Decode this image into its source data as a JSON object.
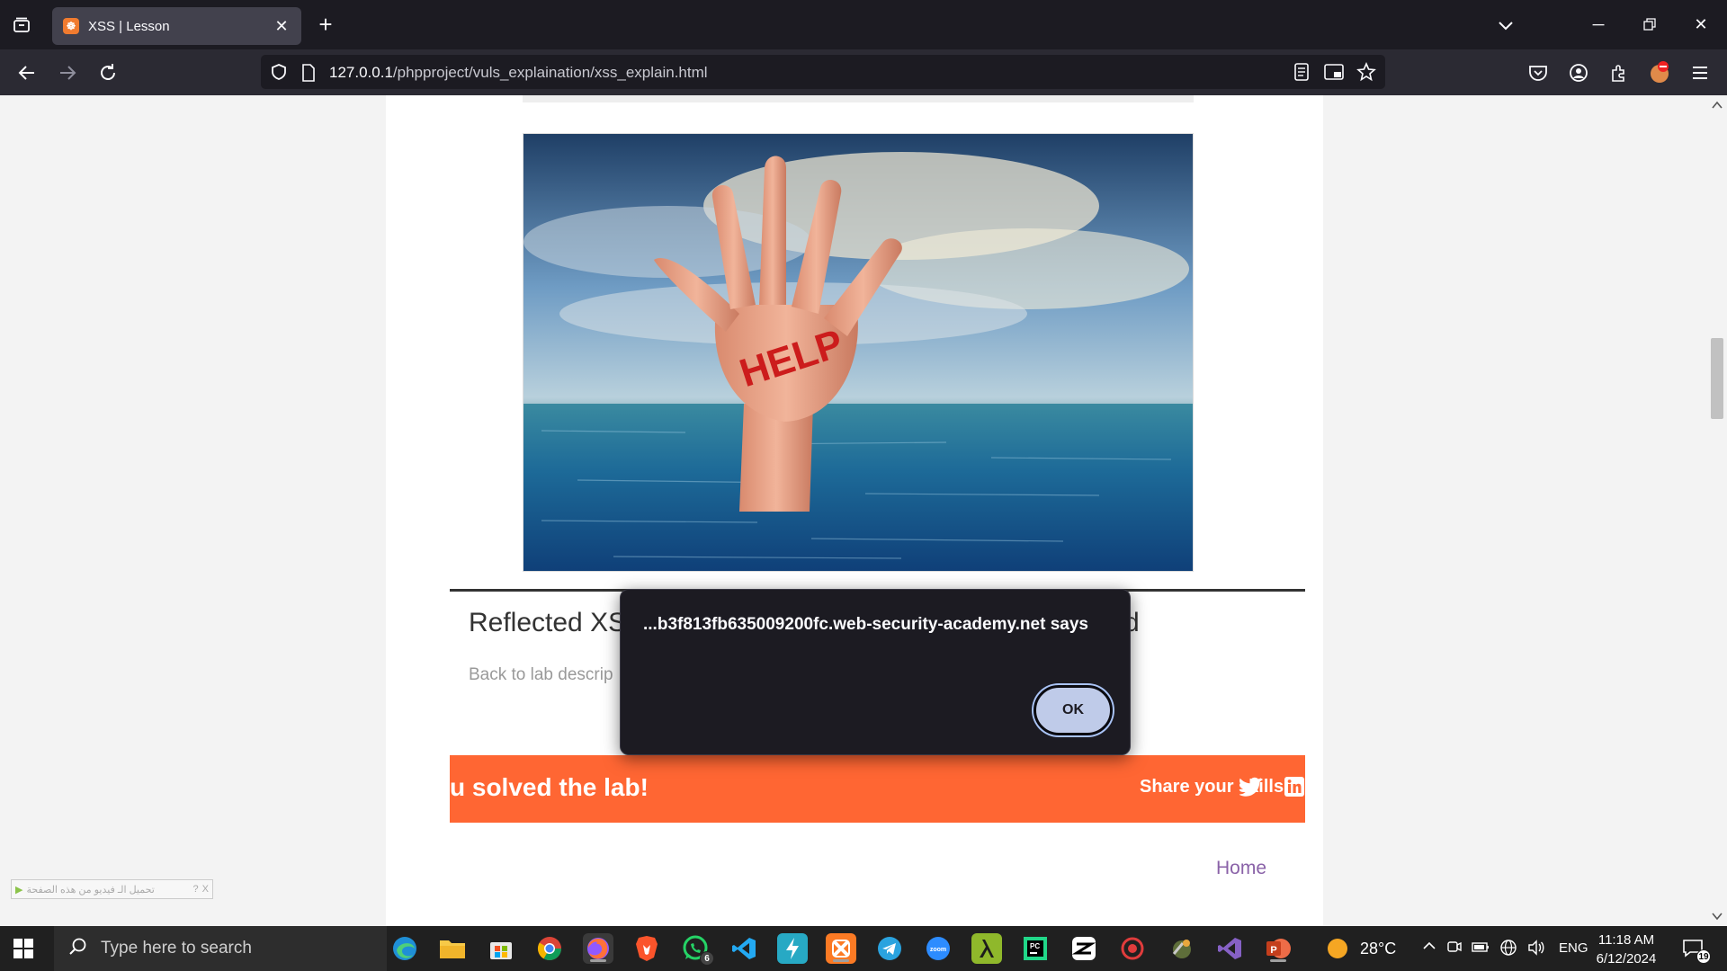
{
  "browser": {
    "tab": {
      "title": "XSS | Lesson",
      "favicon_text": "☸"
    },
    "url": {
      "host": "127.0.0.1",
      "path": "/phpproject/vuls_explaination/xss_explain.html"
    }
  },
  "page": {
    "lab_title": "Reflected XS",
    "lab_title_tail": "d",
    "back_link": "Back to lab descrip",
    "banner": {
      "solved_text": "u solved the lab!",
      "share_text": "Share your skills!"
    },
    "hero_text": "HELP",
    "home_link": "Home",
    "ext_widget_text": "تحميل الـ فيديو من هذه الصفحة"
  },
  "alert": {
    "message": "...b3f813fb635009200fc.web-security-academy.net says",
    "ok_label": "OK"
  },
  "taskbar": {
    "search_placeholder": "Type here to search",
    "whatsapp_badge": "6",
    "weather": "28°C",
    "language": "ENG",
    "time": "11:18 AM",
    "date": "6/12/2024",
    "notification_count": "19"
  },
  "colors": {
    "banner": "#ff6633",
    "home_link": "#8a62a8",
    "ok_button": "#bfcbe9"
  }
}
